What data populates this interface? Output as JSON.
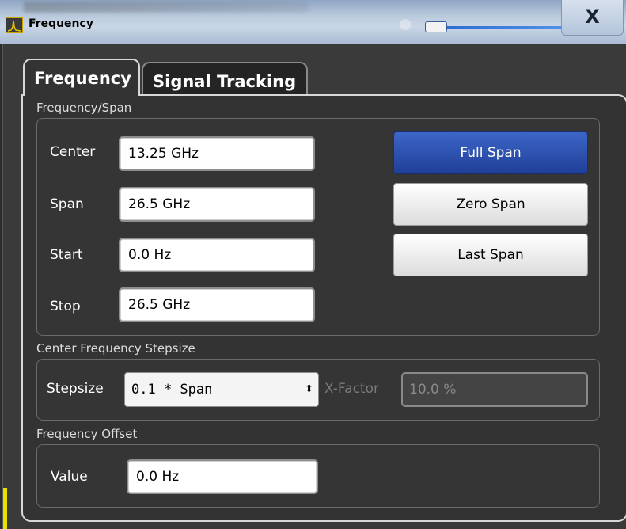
{
  "window": {
    "title": "Frequency",
    "close_label": "X"
  },
  "tabs": [
    {
      "label": "Frequency",
      "active": true
    },
    {
      "label": "Signal Tracking",
      "active": false
    }
  ],
  "frequency_span": {
    "section_label": "Frequency/Span",
    "center": {
      "label": "Center",
      "value": "13.25 GHz"
    },
    "span": {
      "label": "Span",
      "value": "26.5 GHz"
    },
    "start": {
      "label": "Start",
      "value": "0.0 Hz"
    },
    "stop": {
      "label": "Stop",
      "value": "26.5 GHz"
    },
    "full_span_label": "Full Span",
    "zero_span_label": "Zero Span",
    "last_span_label": "Last Span"
  },
  "stepsize": {
    "section_label": "Center Frequency Stepsize",
    "label": "Stepsize",
    "selected": "0.1 * Span",
    "arrow": "⬍",
    "xfactor_label": "X-Factor",
    "xfactor_value": "10.0 %"
  },
  "offset": {
    "section_label": "Frequency Offset",
    "label": "Value",
    "value": "0.0 Hz"
  },
  "colors": {
    "primary_button": "#2c4fb0",
    "panel_bg": "#333333",
    "accent_yellow": "#e7e000"
  }
}
